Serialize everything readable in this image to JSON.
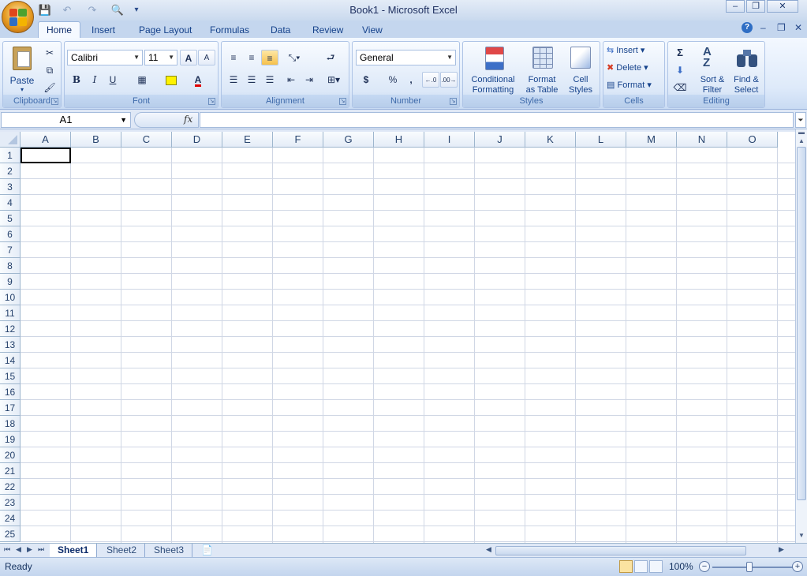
{
  "window": {
    "title": "Book1 - Microsoft Excel",
    "minimize": "–",
    "restore": "❐",
    "close": "✕"
  },
  "qat": {
    "save": "💾",
    "undo": "↶",
    "redo": "↷",
    "preview": "🔍",
    "customize": "▾"
  },
  "tabs": [
    "Home",
    "Insert",
    "Page Layout",
    "Formulas",
    "Data",
    "Review",
    "View"
  ],
  "ribbon_controls": {
    "help": "?",
    "minimize": "–",
    "restore": "❐",
    "close": "✕"
  },
  "groups": {
    "clipboard": {
      "label": "Clipboard",
      "paste": "Paste"
    },
    "font": {
      "label": "Font",
      "font_name": "Calibri",
      "font_size": "11",
      "bold": "B",
      "italic": "I",
      "underline": "U",
      "grow": "A",
      "shrink": "A"
    },
    "alignment": {
      "label": "Alignment"
    },
    "number": {
      "label": "Number",
      "format": "General",
      "currency": "$",
      "percent": "%",
      "comma": ","
    },
    "styles": {
      "label": "Styles",
      "conditional_1": "Conditional",
      "conditional_2": "Formatting",
      "format_table_1": "Format",
      "format_table_2": "as Table",
      "cell_styles_1": "Cell",
      "cell_styles_2": "Styles"
    },
    "cells": {
      "label": "Cells",
      "insert": "Insert",
      "delete": "Delete",
      "format": "Format"
    },
    "editing": {
      "label": "Editing",
      "sum": "Σ",
      "sort_1": "Sort &",
      "sort_2": "Filter",
      "find_1": "Find &",
      "find_2": "Select"
    }
  },
  "formula_bar": {
    "name_box": "A1",
    "fx": "fx",
    "value": ""
  },
  "grid": {
    "columns": [
      "A",
      "B",
      "C",
      "D",
      "E",
      "F",
      "G",
      "H",
      "I",
      "J",
      "K",
      "L",
      "M",
      "N",
      "O"
    ],
    "rows": [
      "1",
      "2",
      "3",
      "4",
      "5",
      "6",
      "7",
      "8",
      "9",
      "10",
      "11",
      "12",
      "13",
      "14",
      "15",
      "16",
      "17",
      "18",
      "19",
      "20",
      "21",
      "22",
      "23",
      "24",
      "25"
    ]
  },
  "sheets": [
    "Sheet1",
    "Sheet2",
    "Sheet3"
  ],
  "status": {
    "text": "Ready",
    "zoom": "100%"
  },
  "colors": {
    "accent": "#15428b",
    "office_button": "#e59a21",
    "ribbon_bg": "#deeafa",
    "grid_line": "#d0d7e5"
  }
}
